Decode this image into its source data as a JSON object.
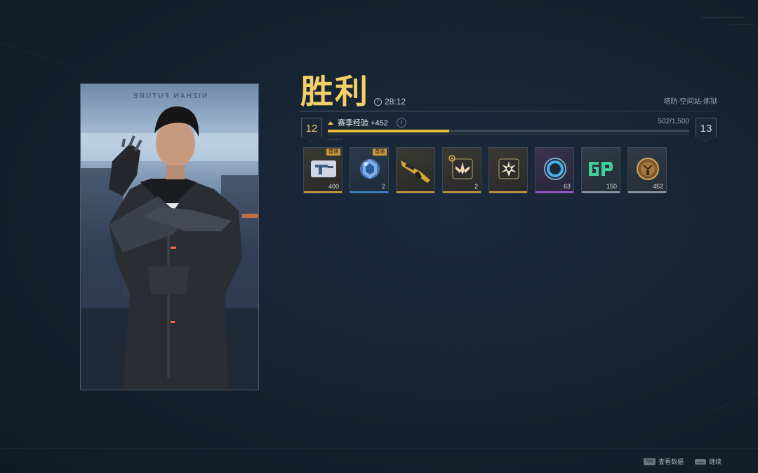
{
  "result": {
    "title": "胜利",
    "duration": "28:12",
    "map_name": "塔防-空间站-炼狱"
  },
  "portrait": {
    "brand_text": "NIZHAN FUTURE"
  },
  "level": {
    "current": "12",
    "next": "13",
    "xp_label": "赛季经验 +452",
    "xp_progress_text": "502/1,500",
    "xp_fraction": 0.335,
    "info_glyph": "i",
    "tiny_code": "NIZHAN-N0"
  },
  "rewards": [
    {
      "icon": "ticket-card-icon",
      "quantity": "400",
      "tag": "首通",
      "rarity": "gold"
    },
    {
      "icon": "blue-crystal-icon",
      "quantity": "2",
      "tag": "首通",
      "rarity": "blue"
    },
    {
      "icon": "gold-rifle-icon",
      "quantity": "",
      "tag": "",
      "rarity": "gold"
    },
    {
      "icon": "wing-emblem-icon",
      "quantity": "2",
      "tag": "",
      "rarity": "gold"
    },
    {
      "icon": "burst-emblem-icon",
      "quantity": "",
      "tag": "",
      "rarity": "gold"
    },
    {
      "icon": "ring-orb-icon",
      "quantity": "63",
      "tag": "",
      "rarity": "purple"
    },
    {
      "icon": "gp-coin-icon",
      "quantity": "150",
      "tag": "",
      "rarity": "grey"
    },
    {
      "icon": "bronze-medal-icon",
      "quantity": "452",
      "tag": "",
      "rarity": "grey"
    }
  ],
  "footer": {
    "tab_key": "Tab",
    "view_data_label": "查看数据",
    "continue_label": "继续"
  },
  "colors": {
    "accent_gold": "#f3cf6a",
    "xp_fill": "#e9b93a",
    "background": "#15222f"
  }
}
